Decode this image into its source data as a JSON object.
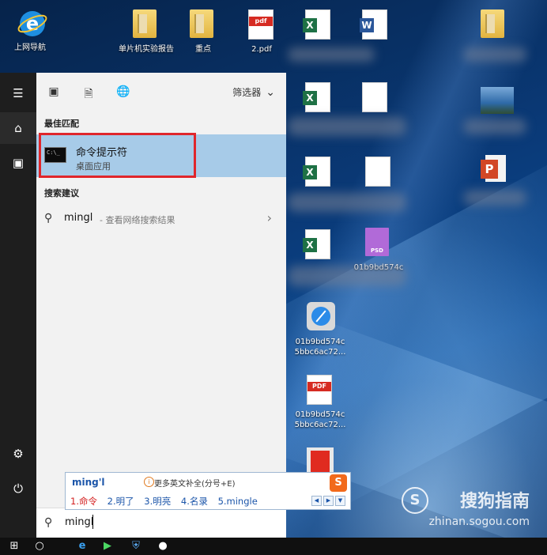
{
  "desktop": {
    "icons": [
      {
        "label": "上网导航",
        "type": "ie"
      },
      {
        "label": "单片机实验报告",
        "type": "folder"
      },
      {
        "label": "重点",
        "type": "folder"
      },
      {
        "label": "2.pdf",
        "type": "pdf"
      },
      {
        "label": "",
        "type": "excel"
      },
      {
        "label": "",
        "type": "word"
      },
      {
        "label": "",
        "type": "folder"
      },
      {
        "label": "",
        "type": "excel"
      },
      {
        "label": "",
        "type": "doc"
      },
      {
        "label": "",
        "type": "image"
      },
      {
        "label": "",
        "type": "excel"
      },
      {
        "label": "",
        "type": "doc"
      },
      {
        "label": "",
        "type": "powerpoint"
      },
      {
        "label": "",
        "type": "excel"
      },
      {
        "label": "01b9bd574c",
        "type": "psd"
      },
      {
        "label": "01b9bd574c\n5bbc6ac72...",
        "type": "safari"
      },
      {
        "label": "01b9bd574c\n5bbc6ac72...",
        "type": "pdf"
      },
      {
        "label": "",
        "type": "pdf-reader"
      }
    ]
  },
  "start_menu": {
    "rail": [
      "hamburger-icon",
      "home-icon",
      "document-icon",
      "settings-icon",
      "power-icon"
    ],
    "toolbar": {
      "filter_label": "筛选器"
    },
    "best_match_header": "最佳匹配",
    "best_match": {
      "title": "命令提示符",
      "subtitle": "桌面应用",
      "icon_text": "C:\\_"
    },
    "suggestions_header": "搜索建议",
    "suggestion": {
      "query": "mingl",
      "desc": "- 查看网络搜索结果"
    },
    "search": {
      "value": "mingl"
    }
  },
  "ime": {
    "composition": "ming'l",
    "tip": "更多英文补全(分号+E)",
    "candidates": [
      "1.命令",
      "2.明了",
      "3.明亮",
      "4.名录",
      "5.mingle"
    ],
    "logo": "S"
  },
  "watermark": {
    "cn": "搜狗指南",
    "en": "zhinan.sogou.com",
    "logo": "S"
  },
  "colors": {
    "selection": "#a7cbe8",
    "highlight_box": "#e0262b",
    "ime_text": "#1b55a9"
  }
}
